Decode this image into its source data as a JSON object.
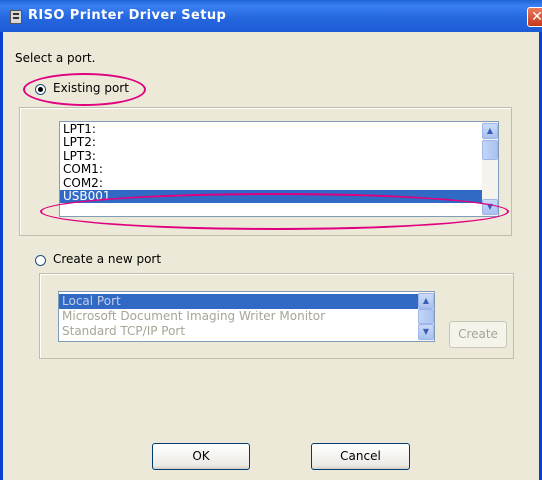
{
  "window": {
    "title": "RISO Printer Driver Setup",
    "close_glyph": "✕"
  },
  "prompt": "Select a port.",
  "existing_port": {
    "label": "Existing port",
    "selected": true,
    "items": [
      "LPT1:",
      "LPT2:",
      "LPT3:",
      "COM1:",
      "COM2:",
      "USB001"
    ],
    "selected_item": "USB001"
  },
  "new_port": {
    "label": "Create a new port",
    "selected": false,
    "items": [
      "Local Port",
      "Microsoft Document Imaging Writer Monitor",
      "Standard TCP/IP Port"
    ],
    "selected_item": "Local Port",
    "create_label": "Create"
  },
  "buttons": {
    "ok": "OK",
    "cancel": "Cancel"
  },
  "colors": {
    "title_bar": "#2667de",
    "selection": "#316ac5",
    "highlight_ellipse": "#e0007f",
    "dialog_bg": "#ece9d8"
  },
  "icons": {
    "app": "printer-icon",
    "close": "close-icon",
    "up": "scroll-up-icon",
    "down": "scroll-down-icon"
  }
}
